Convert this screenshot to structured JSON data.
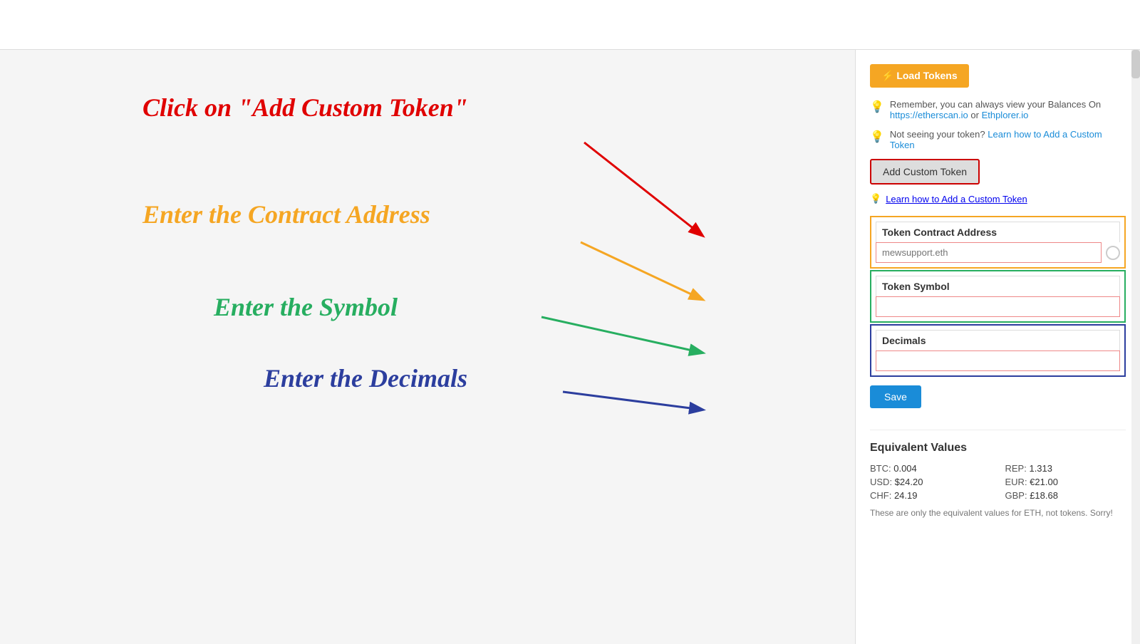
{
  "topbar": {
    "title": ""
  },
  "annotations": {
    "label_red": "Click on \"Add Custom Token\"",
    "label_orange": "Enter the Contract Address",
    "label_green": "Enter the Symbol",
    "label_blue": "Enter the Decimals"
  },
  "right_panel": {
    "load_tokens_btn": "⚡ Load Tokens",
    "info1_text": "Remember, you can always view your Balances On",
    "info1_link1": "https://etherscan.io",
    "info1_link1_text": "https://etherscan.io",
    "info1_or": " or ",
    "info1_link2_text": "Ethplorer.io",
    "info2_prefix": "Not seeing your token?",
    "info2_link_text": "Learn how to Add a Custom Token",
    "add_custom_btn": "Add Custom Token",
    "learn_link": "Learn how to Add a Custom Token",
    "contract_address_label": "Token Contract Address",
    "contract_address_placeholder": "mewsupport.eth",
    "token_symbol_label": "Token Symbol",
    "token_symbol_placeholder": "",
    "decimals_label": "Decimals",
    "decimals_placeholder": "",
    "save_btn": "Save",
    "equiv_title": "Equivalent Values",
    "equiv": [
      {
        "key": "BTC:",
        "value": "0.004",
        "key2": "REP:",
        "value2": "1.313"
      },
      {
        "key": "USD:",
        "value": "$24.20",
        "key2": "EUR:",
        "value2": "€21.00"
      },
      {
        "key": "CHF:",
        "value": "24.19",
        "key2": "GBP:",
        "value2": "£18.68"
      }
    ],
    "equiv_note": "These are only the equivalent values for ETH, not tokens. Sorry!"
  },
  "colors": {
    "red": "#e00000",
    "orange": "#f5a623",
    "green": "#27ae60",
    "blue": "#2c3e9e",
    "link_blue": "#1a8cd8",
    "btn_orange": "#f5a623",
    "btn_blue": "#1a8cd8",
    "border_red_highlight": "#c00"
  }
}
